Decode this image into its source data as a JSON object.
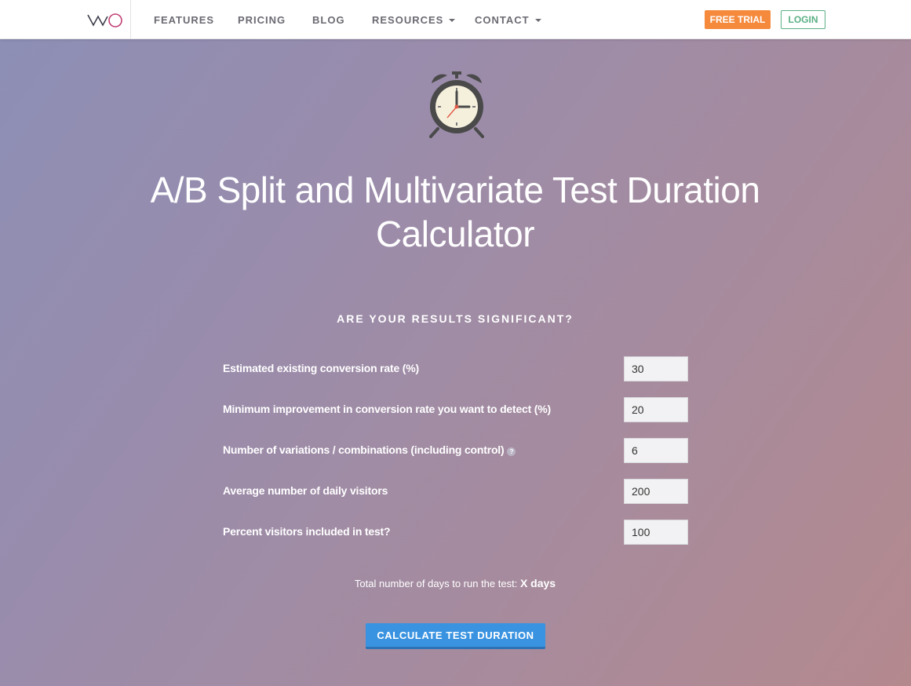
{
  "nav": {
    "logo_text": "VWO",
    "items": [
      {
        "label": "FEATURES",
        "dropdown": false
      },
      {
        "label": "PRICING",
        "dropdown": false
      },
      {
        "label": "BLOG",
        "dropdown": false
      },
      {
        "label": "RESOURCES",
        "dropdown": true
      },
      {
        "label": "CONTACT",
        "dropdown": true
      }
    ],
    "free_trial_label": "FREE TRIAL",
    "login_label": "LOGIN"
  },
  "hero": {
    "icon": "alarm-clock-icon",
    "title": "A/B Split and Multivariate Test Duration Calculator"
  },
  "form": {
    "heading": "ARE YOUR RESULTS SIGNIFICANT?",
    "rows": [
      {
        "label": "Estimated existing conversion rate (%)",
        "value": "30"
      },
      {
        "label": "Minimum improvement in conversion rate you want to detect (%)",
        "value": "20"
      },
      {
        "label": "Number of variations / combinations (including control)",
        "value": "6",
        "help": "?"
      },
      {
        "label": "Average number of daily visitors",
        "value": "200"
      },
      {
        "label": "Percent visitors included in test?",
        "value": "100"
      }
    ],
    "result_text": "Total number of days to run the test:",
    "result_value": "X days",
    "button_label": "CALCULATE TEST DURATION"
  },
  "colors": {
    "free_trial": "#f58a3d",
    "login": "#5cb085",
    "button": "#3a93e0",
    "clock_frame": "#4a4a4a",
    "clock_face": "#f5f0dc",
    "clock_hand_red": "#e05a47"
  }
}
